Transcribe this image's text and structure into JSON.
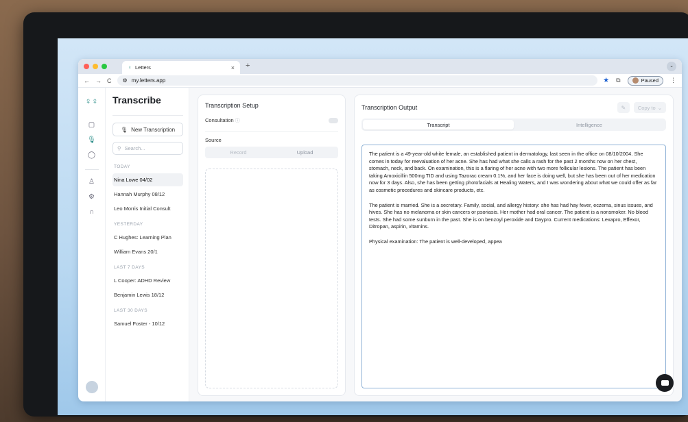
{
  "browser": {
    "tab_title": "Letters",
    "tab_close": "×",
    "new_tab": "+",
    "url": "my.letters.app",
    "profile_label": "Paused",
    "nav_back": "←",
    "nav_forward": "→",
    "reload": "C"
  },
  "rail": {
    "logo": "♀♀"
  },
  "sidebar": {
    "title": "Transcribe",
    "new_button": "New Transcription",
    "search_placeholder": "Search...",
    "groups": [
      {
        "label": "TODAY",
        "items": [
          "Nina Lowe 04/02",
          "Hannah Murphy 08/12",
          "Leo Morris Initial Consult"
        ]
      },
      {
        "label": "YESTERDAY",
        "items": [
          "C Hughes: Learning Plan",
          "William Evans 20/1"
        ]
      },
      {
        "label": "LAST 7 DAYS",
        "items": [
          "L Cooper: ADHD Review",
          "Benjamin Lewis 18/12"
        ]
      },
      {
        "label": "LAST 30 DAYS",
        "items": [
          "Samuel Foster - 10/12"
        ]
      }
    ],
    "selected": "Nina Lowe 04/02"
  },
  "setup": {
    "title": "Transcription Setup",
    "consultation_label": "Consultation",
    "source_label": "Source",
    "record_label": "Record",
    "upload_label": "Upload"
  },
  "output": {
    "title": "Transcription Output",
    "copy_label": "Copy to",
    "tabs": [
      "Transcript",
      "Intelligence"
    ],
    "active_tab": "Transcript",
    "paragraphs": [
      "The patient is a 49-year-old white female, an established patient in dermatology, last seen in the office on 08/10/2004. She comes in today for reevaluation of her acne. She has had what she calls a rash for the past 2 months now on her chest, stomach, neck, and back. On examination, this is a flaring of her acne with two more follicular lesions. The patient has been taking Amoxicillin 500mg TID and using Tazorac cream 0.1%, and her face is doing well, but she has been out of her medication now for 3 days. Also, she has been getting photofacials at Healing Waters, and I was wondering about what we could offer as far as cosmetic procedures and skincare products, etc.",
      "The patient is married. She is a secretary. Family, social, and allergy history: she has had hay fever, eczema, sinus issues, and hives. She has no melanoma or skin cancers or psoriasis. Her mother had oral cancer. The patient is a nonsmoker. No blood tests. She had some sunburn in the past. She is on benzoyl peroxide and Daypro. Current medications: Lexapro, Effexor, Ditropan, aspirin, vitamins.",
      "Physical examination: The patient is well-developed, appea"
    ]
  },
  "colors": {
    "accent": "#2e8f8a",
    "textarea_border": "#8fb2d6",
    "star": "#1a5fd1"
  }
}
